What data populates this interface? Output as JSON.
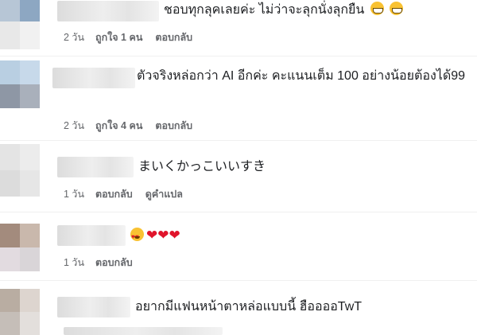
{
  "comments": [
    {
      "text": "ชอบทุกลุคเลยค่ะ ไม่ว่าจะลุกนั่งลุกยืน",
      "emoji": [
        "grinning-face-icon",
        "grinning-face-icon"
      ],
      "time": "2 วัน",
      "likes": "ถูกใจ 1 คน",
      "reply": "ตอบกลับ"
    },
    {
      "text": "ตัวจริงหล่อกว่า AI อีกค่ะ คะแนนเต็ม 100 อย่างน้อยต้องได้99",
      "time": "2 วัน",
      "likes": "ถูกใจ 4 คน",
      "reply": "ตอบกลับ"
    },
    {
      "text": "まいくかっこいいすき",
      "time": "1 วัน",
      "reply": "ตอบกลับ",
      "translate": "ดูคำแปล"
    },
    {
      "text": "",
      "emoji": [
        "smiling-face-heart-eyes-icon",
        "red-heart-icon",
        "red-heart-icon",
        "red-heart-icon"
      ],
      "time": "1 วัน",
      "reply": "ตอบกลับ"
    },
    {
      "text": "อยากมีแฟนหน้าตาหล่อแบบนี้ ฮืออออTwT"
    }
  ],
  "colors": {
    "text": "#1c1e21",
    "meta": "#65676b",
    "heart": "#e0142b"
  }
}
